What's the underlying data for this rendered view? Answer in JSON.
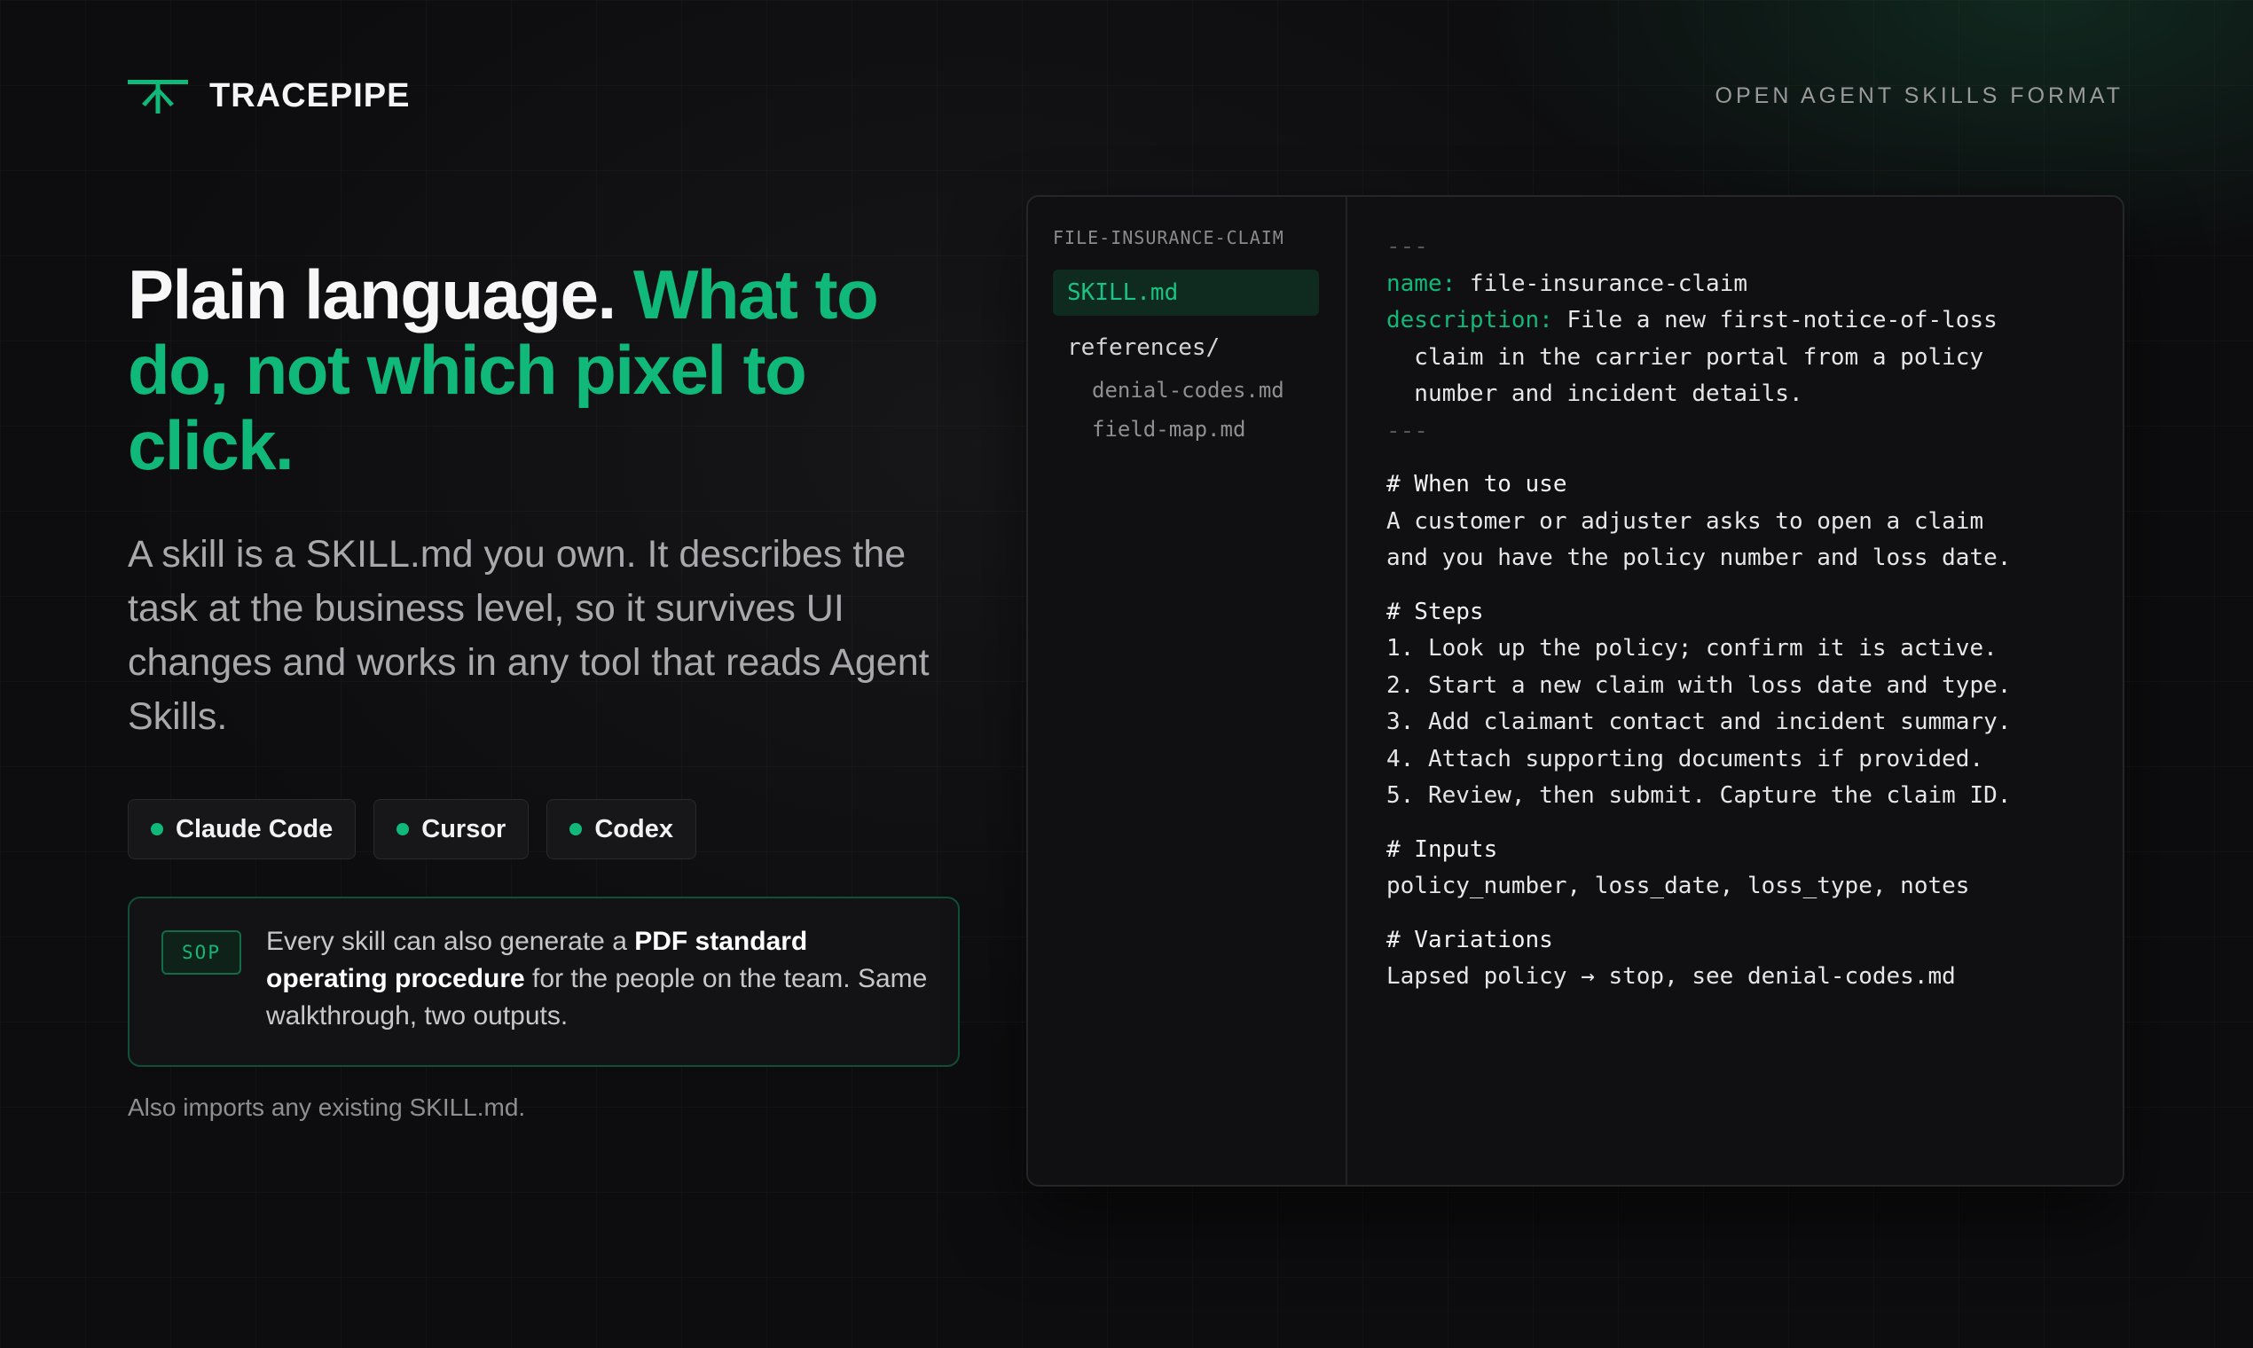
{
  "brand": {
    "name": "TRACEPIPE",
    "logo_icon": "tracepipe-logo-icon",
    "accent": "#10b97a"
  },
  "header": {
    "format_label": "OPEN AGENT SKILLS FORMAT"
  },
  "hero": {
    "headline_white": "Plain language. ",
    "headline_green": "What to do, not which pixel to click.",
    "lede": "A skill is a SKILL.md you own. It describes the task at the business level, so it survives UI changes and works in any tool that reads Agent Skills."
  },
  "tools": [
    {
      "label": "Claude Code"
    },
    {
      "label": "Cursor"
    },
    {
      "label": "Codex"
    }
  ],
  "sop": {
    "badge": "SOP",
    "text_before": "Every skill can also generate a ",
    "text_bold": "PDF standard operating procedure",
    "text_after": " for the people on the team. Same walkthrough, two outputs."
  },
  "imports_note": "Also imports any existing SKILL.md.",
  "file_tree": {
    "title": "FILE-INSURANCE-CLAIM",
    "active_file": "SKILL.md",
    "folder": "references/",
    "files": [
      "denial-codes.md",
      "field-map.md"
    ]
  },
  "skill_md": {
    "frontmatter_dash": "---",
    "name_key": "name:",
    "name_value": " file-insurance-claim",
    "desc_key": "description:",
    "desc_line1": " File a new first-notice-of-loss",
    "desc_line2": "  claim in the carrier portal from a policy",
    "desc_line3": "  number and incident details.",
    "when_heading": "# When to use",
    "when_lines": [
      "A customer or adjuster asks to open a claim",
      "and you have the policy number and loss date."
    ],
    "steps_heading": "# Steps",
    "steps": [
      "1. Look up the policy; confirm it is active.",
      "2. Start a new claim with loss date and type.",
      "3. Add claimant contact and incident summary.",
      "4. Attach supporting documents if provided.",
      "5. Review, then submit. Capture the claim ID."
    ],
    "inputs_heading": "# Inputs",
    "inputs_line": "policy_number, loss_date, loss_type, notes",
    "variations_heading": "# Variations",
    "variations_line": "Lapsed policy → stop, see denial-codes.md"
  }
}
